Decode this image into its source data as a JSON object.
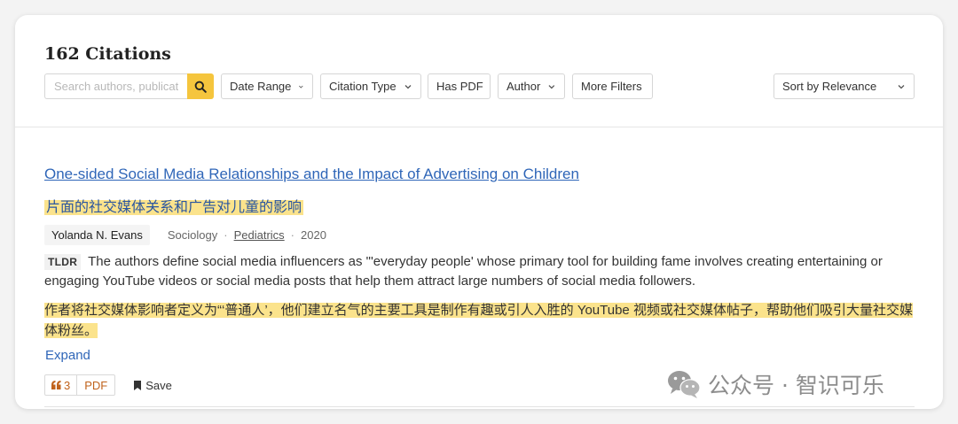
{
  "header": {
    "count_title": "162 Citations",
    "search": {
      "placeholder": "Search authors, publications",
      "value": ""
    },
    "filters": [
      "Date Range",
      "Citation Type",
      "Has PDF",
      "Author",
      "More Filters"
    ],
    "sort": {
      "label": "Sort by Relevance"
    }
  },
  "result": {
    "title": "One-sided Social Media Relationships and the Impact of Advertising on Children",
    "title_zh": "片面的社交媒体关系和广告对儿童的影响",
    "author": "Yolanda N. Evans",
    "field": "Sociology",
    "field_link": "Pediatrics",
    "year": "2020",
    "tldr_badge": "TLDR",
    "tldr": "The authors define social media influencers as \"'everyday people' whose primary tool for building fame involves creating entertaining or engaging YouTube videos or social media posts that help them attract large numbers of social media followers.",
    "tldr_zh": "作者将社交媒体影响者定义为“‘普通人’，他们建立名气的主要工具是制作有趣或引人入胜的 YouTube 视频或社交媒体帖子，帮助他们吸引大量社交媒体粉丝。",
    "expand_label": "Expand",
    "citation_count": "3",
    "pdf_label": "PDF",
    "save_label": "Save"
  },
  "watermark": {
    "text": "公众号 · 智识可乐"
  },
  "colors": {
    "accent_yellow": "#f5c53d",
    "highlight": "#fbe38c",
    "link_blue": "#2f66b8",
    "cite_orange": "#c0621b"
  }
}
